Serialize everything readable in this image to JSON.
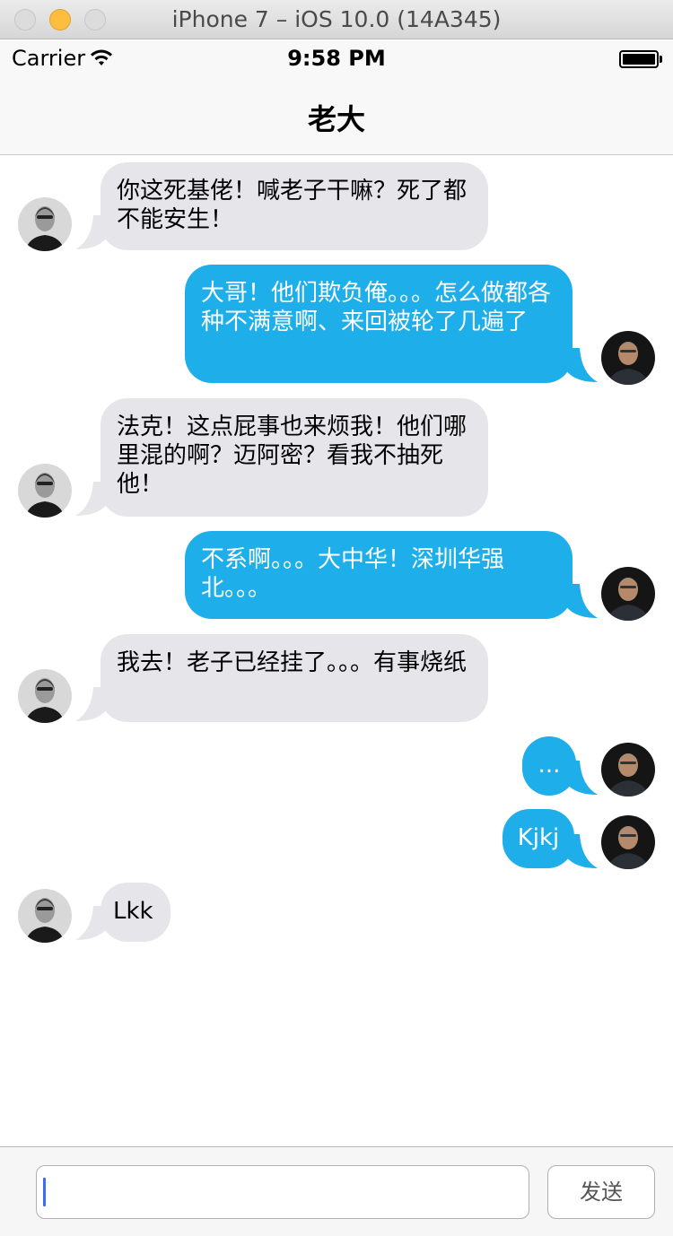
{
  "window": {
    "title": "iPhone 7 – iOS 10.0 (14A345)"
  },
  "status_bar": {
    "carrier": "Carrier",
    "time": "9:58 PM"
  },
  "nav": {
    "title": "老大"
  },
  "messages": [
    {
      "side": "in",
      "text": "你这死基佬！喊老子干嘛？死了都不能安生！"
    },
    {
      "side": "out",
      "text": "大哥！他们欺负俺。。。怎么做都各种不满意啊、来回被轮了几遍了"
    },
    {
      "side": "in",
      "text": "法克！这点屁事也来烦我！他们哪里混的啊？迈阿密？看我不抽死他！"
    },
    {
      "side": "out",
      "text": "不系啊。。。大中华！深圳华强北。。。"
    },
    {
      "side": "in",
      "text": "我去！老子已经挂了。。。有事烧纸"
    },
    {
      "side": "out",
      "text": "..."
    },
    {
      "side": "out",
      "text": "Kjkj"
    },
    {
      "side": "in",
      "text": "Lkk"
    }
  ],
  "input": {
    "value": "",
    "placeholder": ""
  },
  "send_button": {
    "label": "发送"
  },
  "colors": {
    "incoming_bubble": "#e5e5ea",
    "outgoing_bubble": "#1eaeea",
    "caret": "#3a6df0"
  },
  "icons": {
    "incoming_avatar": "avatar-incoming",
    "outgoing_avatar": "avatar-outgoing",
    "wifi": "wifi-icon",
    "battery": "battery-icon"
  }
}
